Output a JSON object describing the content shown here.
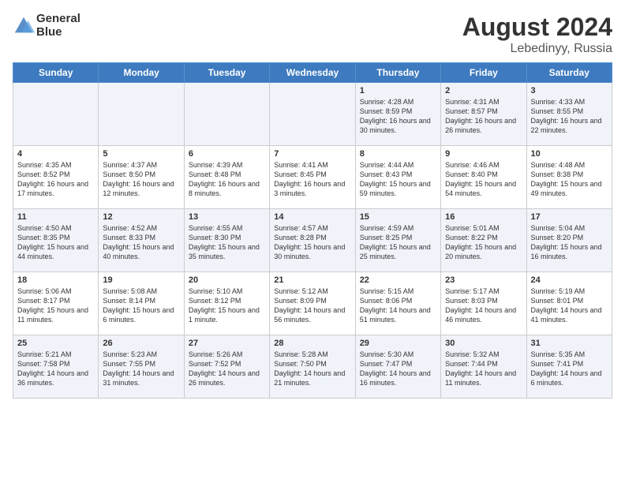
{
  "header": {
    "logo_line1": "General",
    "logo_line2": "Blue",
    "month_year": "August 2024",
    "location": "Lebedinyy, Russia"
  },
  "days_of_week": [
    "Sunday",
    "Monday",
    "Tuesday",
    "Wednesday",
    "Thursday",
    "Friday",
    "Saturday"
  ],
  "weeks": [
    [
      {
        "day": "",
        "content": ""
      },
      {
        "day": "",
        "content": ""
      },
      {
        "day": "",
        "content": ""
      },
      {
        "day": "",
        "content": ""
      },
      {
        "day": "1",
        "content": "Sunrise: 4:28 AM\nSunset: 8:59 PM\nDaylight: 16 hours\nand 30 minutes."
      },
      {
        "day": "2",
        "content": "Sunrise: 4:31 AM\nSunset: 8:57 PM\nDaylight: 16 hours\nand 26 minutes."
      },
      {
        "day": "3",
        "content": "Sunrise: 4:33 AM\nSunset: 8:55 PM\nDaylight: 16 hours\nand 22 minutes."
      }
    ],
    [
      {
        "day": "4",
        "content": "Sunrise: 4:35 AM\nSunset: 8:52 PM\nDaylight: 16 hours\nand 17 minutes."
      },
      {
        "day": "5",
        "content": "Sunrise: 4:37 AM\nSunset: 8:50 PM\nDaylight: 16 hours\nand 12 minutes."
      },
      {
        "day": "6",
        "content": "Sunrise: 4:39 AM\nSunset: 8:48 PM\nDaylight: 16 hours\nand 8 minutes."
      },
      {
        "day": "7",
        "content": "Sunrise: 4:41 AM\nSunset: 8:45 PM\nDaylight: 16 hours\nand 3 minutes."
      },
      {
        "day": "8",
        "content": "Sunrise: 4:44 AM\nSunset: 8:43 PM\nDaylight: 15 hours\nand 59 minutes."
      },
      {
        "day": "9",
        "content": "Sunrise: 4:46 AM\nSunset: 8:40 PM\nDaylight: 15 hours\nand 54 minutes."
      },
      {
        "day": "10",
        "content": "Sunrise: 4:48 AM\nSunset: 8:38 PM\nDaylight: 15 hours\nand 49 minutes."
      }
    ],
    [
      {
        "day": "11",
        "content": "Sunrise: 4:50 AM\nSunset: 8:35 PM\nDaylight: 15 hours\nand 44 minutes."
      },
      {
        "day": "12",
        "content": "Sunrise: 4:52 AM\nSunset: 8:33 PM\nDaylight: 15 hours\nand 40 minutes."
      },
      {
        "day": "13",
        "content": "Sunrise: 4:55 AM\nSunset: 8:30 PM\nDaylight: 15 hours\nand 35 minutes."
      },
      {
        "day": "14",
        "content": "Sunrise: 4:57 AM\nSunset: 8:28 PM\nDaylight: 15 hours\nand 30 minutes."
      },
      {
        "day": "15",
        "content": "Sunrise: 4:59 AM\nSunset: 8:25 PM\nDaylight: 15 hours\nand 25 minutes."
      },
      {
        "day": "16",
        "content": "Sunrise: 5:01 AM\nSunset: 8:22 PM\nDaylight: 15 hours\nand 20 minutes."
      },
      {
        "day": "17",
        "content": "Sunrise: 5:04 AM\nSunset: 8:20 PM\nDaylight: 15 hours\nand 16 minutes."
      }
    ],
    [
      {
        "day": "18",
        "content": "Sunrise: 5:06 AM\nSunset: 8:17 PM\nDaylight: 15 hours\nand 11 minutes."
      },
      {
        "day": "19",
        "content": "Sunrise: 5:08 AM\nSunset: 8:14 PM\nDaylight: 15 hours\nand 6 minutes."
      },
      {
        "day": "20",
        "content": "Sunrise: 5:10 AM\nSunset: 8:12 PM\nDaylight: 15 hours\nand 1 minute."
      },
      {
        "day": "21",
        "content": "Sunrise: 5:12 AM\nSunset: 8:09 PM\nDaylight: 14 hours\nand 56 minutes."
      },
      {
        "day": "22",
        "content": "Sunrise: 5:15 AM\nSunset: 8:06 PM\nDaylight: 14 hours\nand 51 minutes."
      },
      {
        "day": "23",
        "content": "Sunrise: 5:17 AM\nSunset: 8:03 PM\nDaylight: 14 hours\nand 46 minutes."
      },
      {
        "day": "24",
        "content": "Sunrise: 5:19 AM\nSunset: 8:01 PM\nDaylight: 14 hours\nand 41 minutes."
      }
    ],
    [
      {
        "day": "25",
        "content": "Sunrise: 5:21 AM\nSunset: 7:58 PM\nDaylight: 14 hours\nand 36 minutes."
      },
      {
        "day": "26",
        "content": "Sunrise: 5:23 AM\nSunset: 7:55 PM\nDaylight: 14 hours\nand 31 minutes."
      },
      {
        "day": "27",
        "content": "Sunrise: 5:26 AM\nSunset: 7:52 PM\nDaylight: 14 hours\nand 26 minutes."
      },
      {
        "day": "28",
        "content": "Sunrise: 5:28 AM\nSunset: 7:50 PM\nDaylight: 14 hours\nand 21 minutes."
      },
      {
        "day": "29",
        "content": "Sunrise: 5:30 AM\nSunset: 7:47 PM\nDaylight: 14 hours\nand 16 minutes."
      },
      {
        "day": "30",
        "content": "Sunrise: 5:32 AM\nSunset: 7:44 PM\nDaylight: 14 hours\nand 11 minutes."
      },
      {
        "day": "31",
        "content": "Sunrise: 5:35 AM\nSunset: 7:41 PM\nDaylight: 14 hours\nand 6 minutes."
      }
    ]
  ]
}
